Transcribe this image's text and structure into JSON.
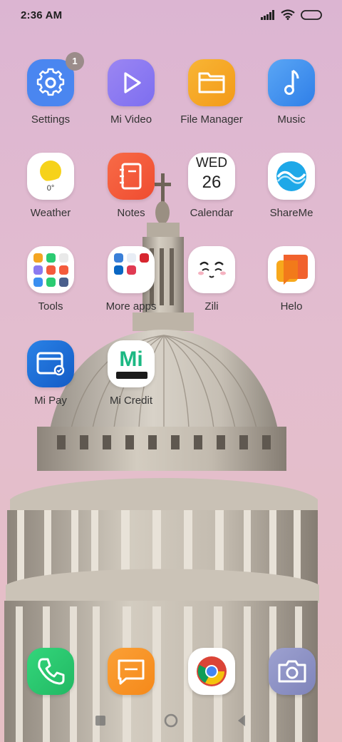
{
  "status_bar": {
    "time": "2:36 AM",
    "icons": [
      "signal-icon",
      "wifi-icon",
      "battery-icon"
    ]
  },
  "apps": [
    {
      "label": "Settings",
      "icon": "gear-icon",
      "badge": "1"
    },
    {
      "label": "Mi Video",
      "icon": "play-icon"
    },
    {
      "label": "File Manager",
      "icon": "folder-icon"
    },
    {
      "label": "Music",
      "icon": "music-note-icon"
    },
    {
      "label": "Weather",
      "icon": "sun-icon",
      "temp": "0°"
    },
    {
      "label": "Notes",
      "icon": "notebook-icon"
    },
    {
      "label": "Calendar",
      "icon": "calendar-icon",
      "day": "WED",
      "date": "26"
    },
    {
      "label": "ShareMe",
      "icon": "shareme-icon"
    },
    {
      "label": "Tools",
      "icon": "tools-folder-icon"
    },
    {
      "label": "More apps",
      "icon": "apps-folder-icon"
    },
    {
      "label": "Zili",
      "icon": "zili-face-icon"
    },
    {
      "label": "Helo",
      "icon": "helo-icon"
    },
    {
      "label": "Mi Pay",
      "icon": "wallet-icon"
    },
    {
      "label": "Mi Credit",
      "icon": "mi-credit-icon",
      "icon_text": "Mi"
    }
  ],
  "dock": [
    {
      "name": "phone",
      "icon": "phone-icon"
    },
    {
      "name": "messaging",
      "icon": "message-icon"
    },
    {
      "name": "chrome",
      "icon": "chrome-icon"
    },
    {
      "name": "camera",
      "icon": "camera-icon"
    }
  ],
  "nav": [
    "recents-icon",
    "home-icon",
    "back-icon"
  ],
  "colors": {
    "settings": "#4a86f0",
    "mi_video": "#8b7af0",
    "file_manager": "#f4a521",
    "music": "#3a8ff0",
    "notes": "#f45b3c",
    "shareme": "#1ea8e8",
    "mi_pay": "#1b6fd8",
    "mi_credit": "#1cb883",
    "phone": "#2bcb72",
    "messaging": "#f7941d",
    "camera": "#8e93c4"
  }
}
